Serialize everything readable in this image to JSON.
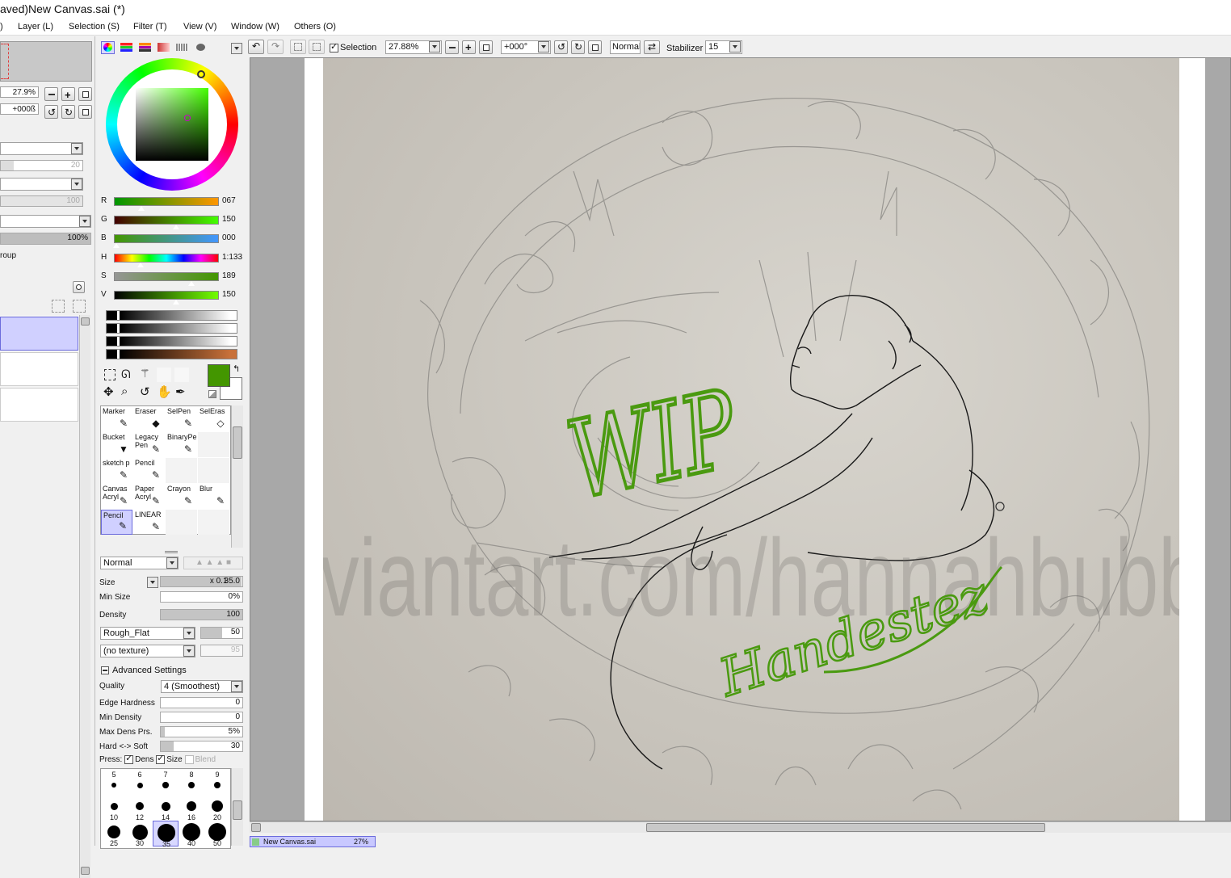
{
  "window": {
    "title": "aved)New Canvas.sai (*)"
  },
  "menu": [
    "Layer (L)",
    "Selection (S)",
    "Filter (T)",
    "View (V)",
    "Window (W)",
    "Others (O)"
  ],
  "menu_lead": ")",
  "navigator": {
    "zoom": "27.9%",
    "angle": "+000ß"
  },
  "layer_panel": {
    "opacity_a": "20",
    "opacity_b": "100",
    "opacity_pct": "100%",
    "group_label": "roup"
  },
  "toolbar": {
    "selection_label": "Selection",
    "zoom": "27.88%",
    "rotation": "+000°",
    "blend": "Normal",
    "stabilizer_label": "Stabilizer",
    "stabilizer": "15"
  },
  "color": {
    "current": "#439600",
    "sliders": [
      {
        "label": "R",
        "value": "067",
        "pos": 0.26
      },
      {
        "label": "G",
        "value": "150",
        "pos": 0.59
      },
      {
        "label": "B",
        "value": "000",
        "pos": 0.02
      },
      {
        "label": "H",
        "value": "1:133",
        "pos": 0.25
      },
      {
        "label": "S",
        "value": "189",
        "pos": 0.74
      },
      {
        "label": "V",
        "value": "150",
        "pos": 0.59
      }
    ]
  },
  "tools": [
    {
      "name": "Marker",
      "name2": "",
      "icon": "✎"
    },
    {
      "name": "Eraser",
      "name2": "",
      "icon": "◆"
    },
    {
      "name": "SelPen",
      "name2": "",
      "icon": "✎"
    },
    {
      "name": "SelEras",
      "name2": "",
      "icon": "◇"
    },
    {
      "name": "Bucket",
      "name2": "",
      "icon": "▼"
    },
    {
      "name": "Legacy",
      "name2": "Pen",
      "icon": "✎"
    },
    {
      "name": "BinaryPe",
      "name2": "",
      "icon": "✎"
    },
    {
      "name": "",
      "name2": "",
      "icon": ""
    },
    {
      "name": "sketch p",
      "name2": "",
      "icon": "✎"
    },
    {
      "name": "Pencil",
      "name2": "",
      "icon": "✎"
    },
    {
      "name": "",
      "name2": "",
      "icon": ""
    },
    {
      "name": "",
      "name2": "",
      "icon": ""
    },
    {
      "name": "Canvas",
      "name2": "Acryl",
      "icon": "✎"
    },
    {
      "name": "Paper",
      "name2": "Acryl",
      "icon": "✎"
    },
    {
      "name": "Crayon",
      "name2": "",
      "icon": "✎"
    },
    {
      "name": "Blur",
      "name2": "",
      "icon": "✎"
    },
    {
      "name": "Pencil",
      "name2": "",
      "icon": "✎"
    },
    {
      "name": "LINEAR",
      "name2": "",
      "icon": "✎"
    },
    {
      "name": "",
      "name2": "",
      "icon": ""
    },
    {
      "name": "",
      "name2": "",
      "icon": ""
    }
  ],
  "brush": {
    "mode": "Normal",
    "size_label": "Size",
    "size_mult": "x 0.1",
    "size_value": "35.0",
    "min_size_label": "Min Size",
    "min_size_value": "0%",
    "density_label": "Density",
    "density_value": "100",
    "shape": "Rough_Flat",
    "shape_value": "50",
    "texture": "(no texture)",
    "texture_value": "95",
    "advanced_label": "Advanced Settings",
    "quality_label": "Quality",
    "quality_value": "4 (Smoothest)",
    "edge_label": "Edge Hardness",
    "edge_value": "0",
    "mindens_label": "Min Density",
    "mindens_value": "0",
    "maxdens_label": "Max Dens Prs.",
    "maxdens_value": "5%",
    "hardsoft_label": "Hard <-> Soft",
    "hardsoft_value": "30",
    "press_label": "Press:",
    "dens_label": "Dens",
    "psize_label": "Size",
    "blend_label": "Blend"
  },
  "brush_sizes": {
    "row1": [
      "5",
      "6",
      "7",
      "8",
      "9"
    ],
    "row2": [
      "10",
      "12",
      "14",
      "16",
      "20"
    ],
    "row3": [
      "25",
      "30",
      "35",
      "40",
      "50"
    ]
  },
  "canvas": {
    "watermark": "www.deviantart.com/hannahbubbles",
    "wip_text": "WIP",
    "signature": "Handestez",
    "tab_label": "New Canvas.sai",
    "tab_zoom": "27%"
  }
}
